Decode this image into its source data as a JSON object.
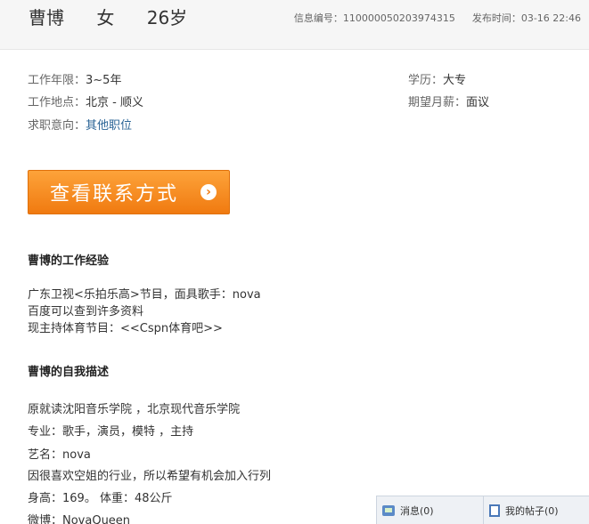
{
  "header": {
    "name": "曹博",
    "gender": "女",
    "age": "26岁",
    "info_id_label": "信息编号：",
    "info_id": "110000050203974315",
    "publish_label": "发布时间：",
    "publish_time": "03-16 22:46"
  },
  "details": {
    "experience_label": "工作年限：",
    "experience": "3~5年",
    "location_label": "工作地点：",
    "location": "北京 - 顺义",
    "intent_label": "求职意向：",
    "intent": "其他职位",
    "education_label": "学历：",
    "education": "大专",
    "salary_label": "期望月薪：",
    "salary": "面议"
  },
  "contact_button": {
    "label": "查看联系方式",
    "arrow": "›",
    "color": "#f58a1f"
  },
  "work_experience": {
    "title": "曹博的工作经验",
    "lines": [
      "广东卫视<乐拍乐高>节目，面具歌手：nova",
      "百度可以查到许多资料",
      "现主持体育节目：<<Cspn体育吧>>"
    ]
  },
  "self_description": {
    "title": "曹博的自我描述",
    "lines": [
      "原就读沈阳音乐学院 ，北京现代音乐学院",
      "专业：歌手，演员，模特 ，主持",
      "艺名：nova",
      "因很喜欢空姐的行业，所以希望有机会加入行列",
      "身高：169。 体重：48公斤",
      "微博：NovaQueen"
    ]
  },
  "bottom_bar": {
    "messages": "消息(0)",
    "my_posts": "我的帖子(0)"
  }
}
